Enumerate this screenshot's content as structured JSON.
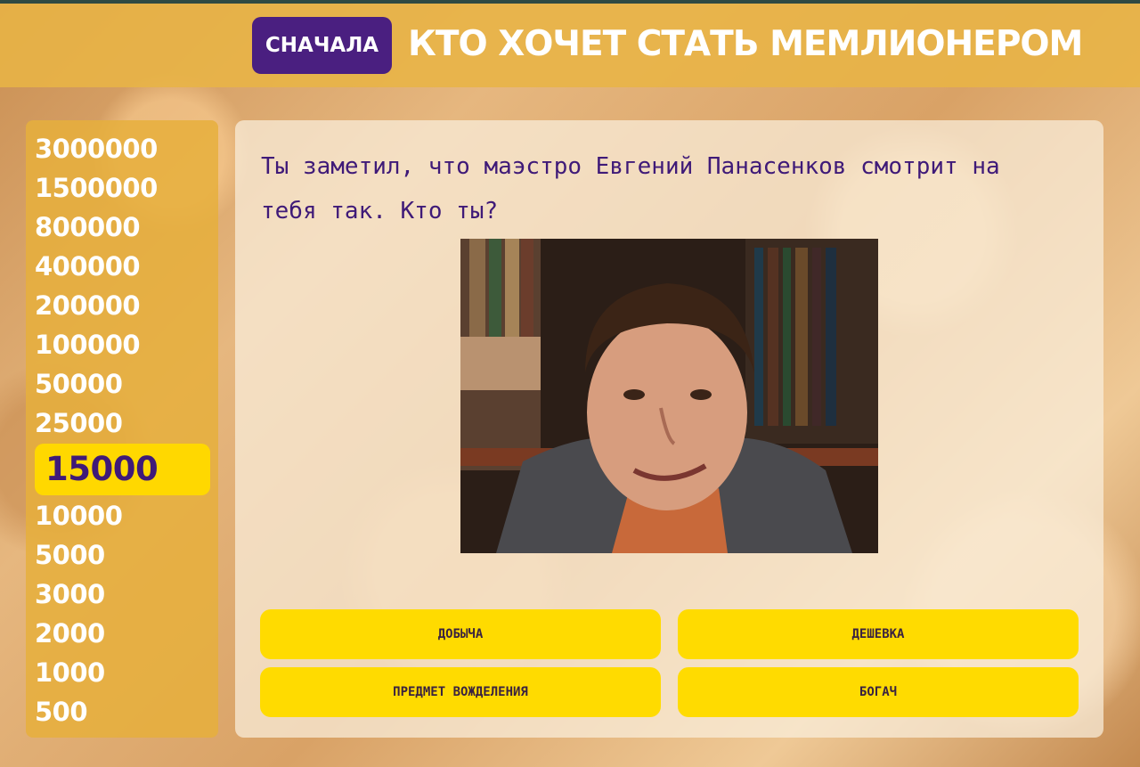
{
  "header": {
    "restart_label": "СНАЧАЛА",
    "title": "КТО ХОЧЕТ СТАТЬ МЕМЛИОНЕРОМ"
  },
  "ladder": {
    "amounts": [
      "3000000",
      "1500000",
      "800000",
      "400000",
      "200000",
      "100000",
      "50000",
      "25000",
      "15000",
      "10000",
      "5000",
      "3000",
      "2000",
      "1000",
      "500"
    ],
    "current": "15000"
  },
  "question": {
    "text": "Ты заметил, что маэстро Евгений Панасенков смотрит на тебя так. Кто ты?"
  },
  "answers": [
    "ДОБЫЧА",
    "ДЕШЕВКА",
    "ПРЕДМЕТ ВОЖДЕЛЕНИЯ",
    "БОГАЧ"
  ],
  "colors": {
    "header": "#e8b446",
    "accent_purple": "#4a1f80",
    "highlight_yellow": "#ffd800"
  }
}
